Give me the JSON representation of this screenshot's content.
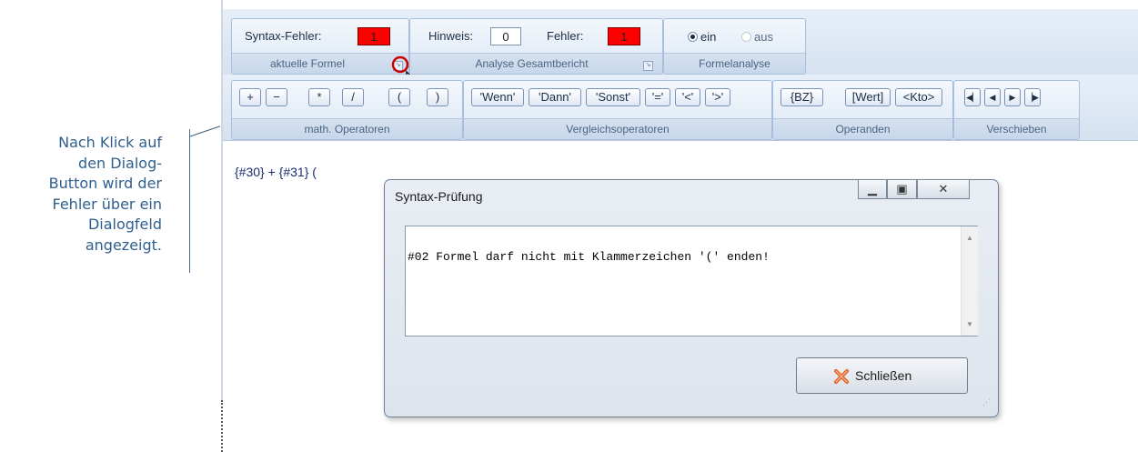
{
  "callout": {
    "text": "Nach Klick auf\nden Dialog-\nButton wird der\nFehler über ein\nDialogfeld\nangezeigt."
  },
  "ribbon": {
    "formula_group": {
      "syntax_label": "Syntax-Fehler:",
      "syntax_value": "1",
      "label": "aktuelle Formel"
    },
    "report_group": {
      "hint_label": "Hinweis:",
      "hint_value": "0",
      "error_label": "Fehler:",
      "error_value": "1",
      "label": "Analyse Gesamtbericht"
    },
    "analysis_group": {
      "on_label": "ein",
      "off_label": "aus",
      "label": "Formelanalyse",
      "selected": "ein"
    },
    "math_group": {
      "buttons": [
        "+",
        "−",
        "*",
        "/",
        "(",
        ")"
      ],
      "label": "math. Operatoren"
    },
    "compare_group": {
      "buttons": [
        "'Wenn'",
        "'Dann'",
        "'Sonst'",
        "'='",
        "'<'",
        "'>'"
      ],
      "label": "Vergleichsoperatoren"
    },
    "operand_group": {
      "buttons": [
        "{BZ}",
        "[Wert]",
        "<Kto>"
      ],
      "label": "Operanden"
    },
    "move_group": {
      "buttons": [
        "first-icon",
        "prev-icon",
        "next-icon",
        "last-icon"
      ],
      "label": "Verschieben"
    }
  },
  "editor": {
    "formula": "{#30} + {#31} ("
  },
  "dialog": {
    "title": "Syntax-Prüfung",
    "message": "#02 Formel darf nicht mit Klammerzeichen '(' enden!",
    "close_label": "Schließen"
  },
  "colors": {
    "error_red": "#ff0000",
    "callout_blue": "#2e5f8f",
    "highlight_circle": "#cc0000"
  }
}
